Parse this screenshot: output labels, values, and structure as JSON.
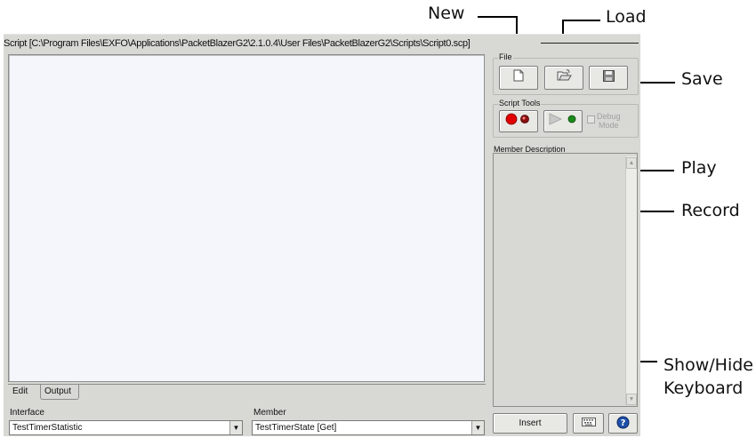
{
  "window": {
    "title": "Script [C:\\Program Files\\EXFO\\Applications\\PacketBlazerG2\\2.1.0.4\\User Files\\PacketBlazerG2\\Scripts\\Script0.scp]"
  },
  "callouts": {
    "new": "New",
    "load": "Load",
    "save": "Save",
    "play": "Play",
    "record": "Record",
    "show_hide_line1": "Show/Hide",
    "show_hide_line2": "Keyboard"
  },
  "tabs": [
    {
      "label": "Edit",
      "active": true
    },
    {
      "label": "Output",
      "active": false
    }
  ],
  "interface": {
    "label": "Interface",
    "value": "TestTimerStatistic"
  },
  "member": {
    "label": "Member",
    "value": "TestTimerState [Get]"
  },
  "file_group": {
    "label": "File",
    "buttons": [
      {
        "name": "New",
        "icon": "new-document-icon"
      },
      {
        "name": "Load",
        "icon": "open-folder-icon"
      },
      {
        "name": "Save",
        "icon": "floppy-disk-icon"
      }
    ]
  },
  "script_tools": {
    "label": "Script Tools",
    "record_icon": "record-icon",
    "play_icon": "play-icon",
    "debug_label_line1": "Debug",
    "debug_label_line2": "Mode",
    "debug_checked": false
  },
  "member_description": {
    "label": "Member Description"
  },
  "bottom_buttons": {
    "insert": "Insert",
    "keyboard_icon": "keyboard-icon",
    "help_icon": "help-icon"
  },
  "colors": {
    "window_bg": "#d8d8d4",
    "editor_bg": "#f4f6fb",
    "record_red": "#e00000",
    "play_green": "#1a8a1a",
    "help_blue": "#1e4fa8"
  }
}
